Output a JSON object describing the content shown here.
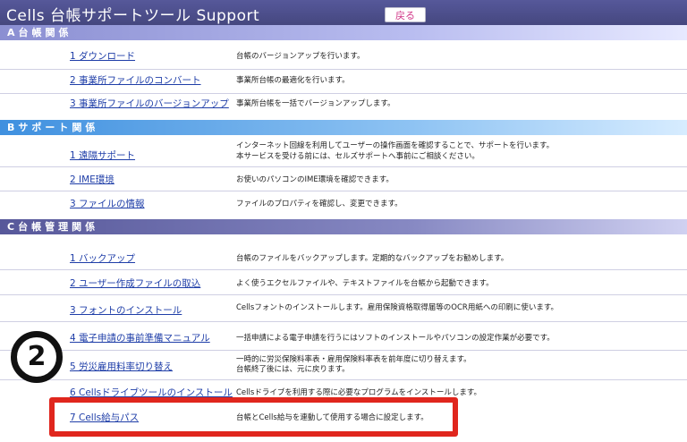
{
  "header": {
    "title": "Cells  台帳サポートツール    Support",
    "back_label": "戻る"
  },
  "sections": [
    {
      "heading": "A台帳関係",
      "items": [
        {
          "label": "1 ダウンロード",
          "desc": [
            "台帳のバージョンアップを行います。"
          ]
        },
        {
          "label": "2 事業所ファイルのコンバート",
          "desc": [
            "事業所台帳の最適化を行います。"
          ]
        },
        {
          "label": "3 事業所ファイルのバージョンアップ",
          "desc": [
            "事業所台帳を一括でバージョンアップします。"
          ]
        }
      ]
    },
    {
      "heading": "Bサポート関係",
      "items": [
        {
          "label": "1 遠隔サポート",
          "desc": [
            "インターネット回線を利用してユーザーの操作画面を確認することで、サポートを行います。",
            "本サービスを受ける前には、セルズサポートへ事前にご相談ください。"
          ]
        },
        {
          "label": "2 IME環境",
          "desc": [
            "お使いのパソコンのIME環境を確認できます。"
          ]
        },
        {
          "label": "3 ファイルの情報",
          "desc": [
            "ファイルのプロパティを確認し、変更できます。"
          ]
        }
      ]
    },
    {
      "heading": "C台帳管理関係",
      "items": [
        {
          "label": "1 バックアップ",
          "desc": [
            "台帳のファイルをバックアップします。定期的なバックアップをお勧めします。"
          ]
        },
        {
          "label": "2 ユーザー作成ファイルの取込",
          "desc": [
            "よく使うエクセルファイルや、テキストファイルを台帳から起動できます。"
          ]
        },
        {
          "label": "3 フォントのインストール",
          "desc": [
            "Cellsフォントのインストールします。雇用保険資格取得届等のOCR用紙への印刷に使います。"
          ]
        },
        {
          "label": "4 電子申請の事前準備マニュアル",
          "desc": [
            "一括申請による電子申請を行うにはソフトのインストールやパソコンの設定作業が必要です。"
          ]
        },
        {
          "label": "5 労災雇用料率切り替え",
          "desc": [
            "一時的に労災保険料率表・雇用保険料率表を前年度に切り替えます。",
            "台帳終了後には、元に戻ります。"
          ]
        },
        {
          "label": "6 Cellsドライブツールのインストール",
          "desc": [
            "Cellsドライブを利用する際に必要なプログラムをインストールします。"
          ]
        },
        {
          "label": "7 Cells給与パス",
          "desc": [
            "台帳とCells給与を連動して使用する場合に設定します。"
          ]
        }
      ]
    }
  ],
  "annotation": {
    "step_number": "2"
  },
  "colors": {
    "title_bar": "#4b4d88",
    "section_a": "#8b8fd2",
    "section_b": "#3f90df",
    "section_c": "#57589a",
    "link": "#1f3ea8",
    "highlight": "#e0261d"
  }
}
